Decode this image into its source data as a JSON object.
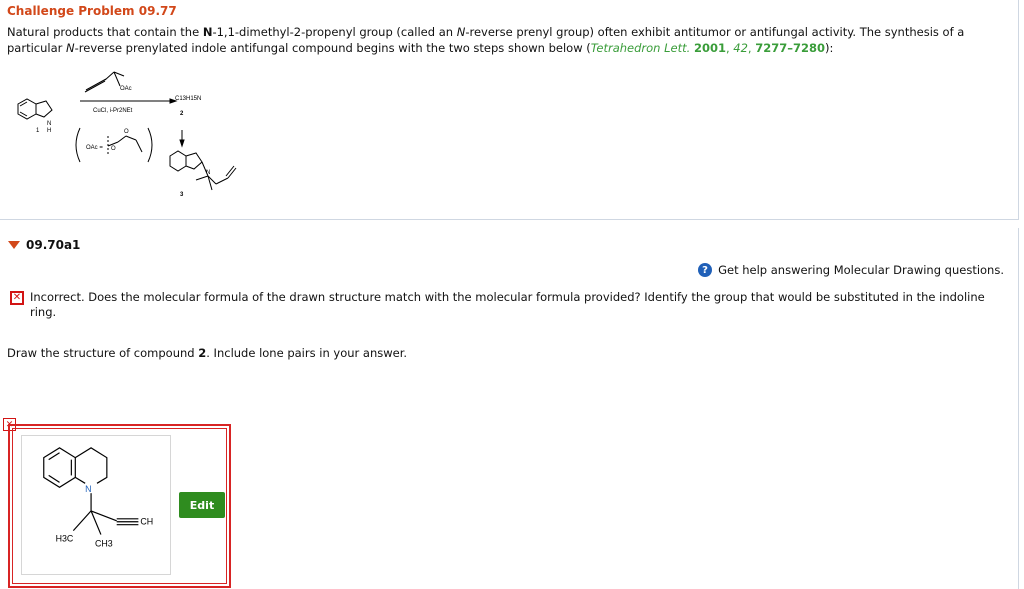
{
  "header": {
    "title": "Challenge Problem 09.77",
    "intro": {
      "p1": "Natural products that contain the ",
      "p2": "N",
      "p3": "-1,1-dimethyl-2-propenyl group (called an ",
      "p4": "N",
      "p5": "-reverse prenyl group) often exhibit antitumor or antifungal activity. The synthesis of a particular ",
      "p6": "N",
      "p7": "-reverse prenylated indole antifungal compound begins with the two steps shown below (",
      "cite_journal": "Tetrahedron Lett.",
      "cite_year": "2001",
      "cite_vol": "42",
      "cite_pages": "7277–7280",
      "p8": "):"
    }
  },
  "scheme": {
    "reagent_top": "OAc",
    "reagent_bottom": "CuCl, i-Pr2NEt",
    "product_formula": "C13H15N",
    "label_1": "1",
    "label_2": "2",
    "label_3": "3",
    "nh_n": "N",
    "nh_h": "H",
    "oac_def": "OAc =",
    "o_top": "O",
    "o_side": "O",
    "n3": "N"
  },
  "part": {
    "label": "09.70a1"
  },
  "help": {
    "icon": "?",
    "text": "Get help answering Molecular Drawing questions."
  },
  "feedback": {
    "icon": "x-mark-icon",
    "text": "Incorrect. Does the molecular formula of the drawn structure match with the molecular formula provided? Identify the group that would be substituted in the indoline ring."
  },
  "prompt": {
    "p1": "Draw the structure of compound ",
    "bold": "2",
    "p2": ". Include lone pairs in your answer."
  },
  "answer": {
    "edit_label": "Edit",
    "atom_n": "N",
    "atom_ch": "CH",
    "atom_h3c": "H3C",
    "atom_ch3": "CH3"
  },
  "colors": {
    "title": "#d2481a",
    "citation": "#3a9d3a",
    "error": "#d21414",
    "edit_button": "#2f8c1f",
    "help_icon": "#2060b8"
  }
}
